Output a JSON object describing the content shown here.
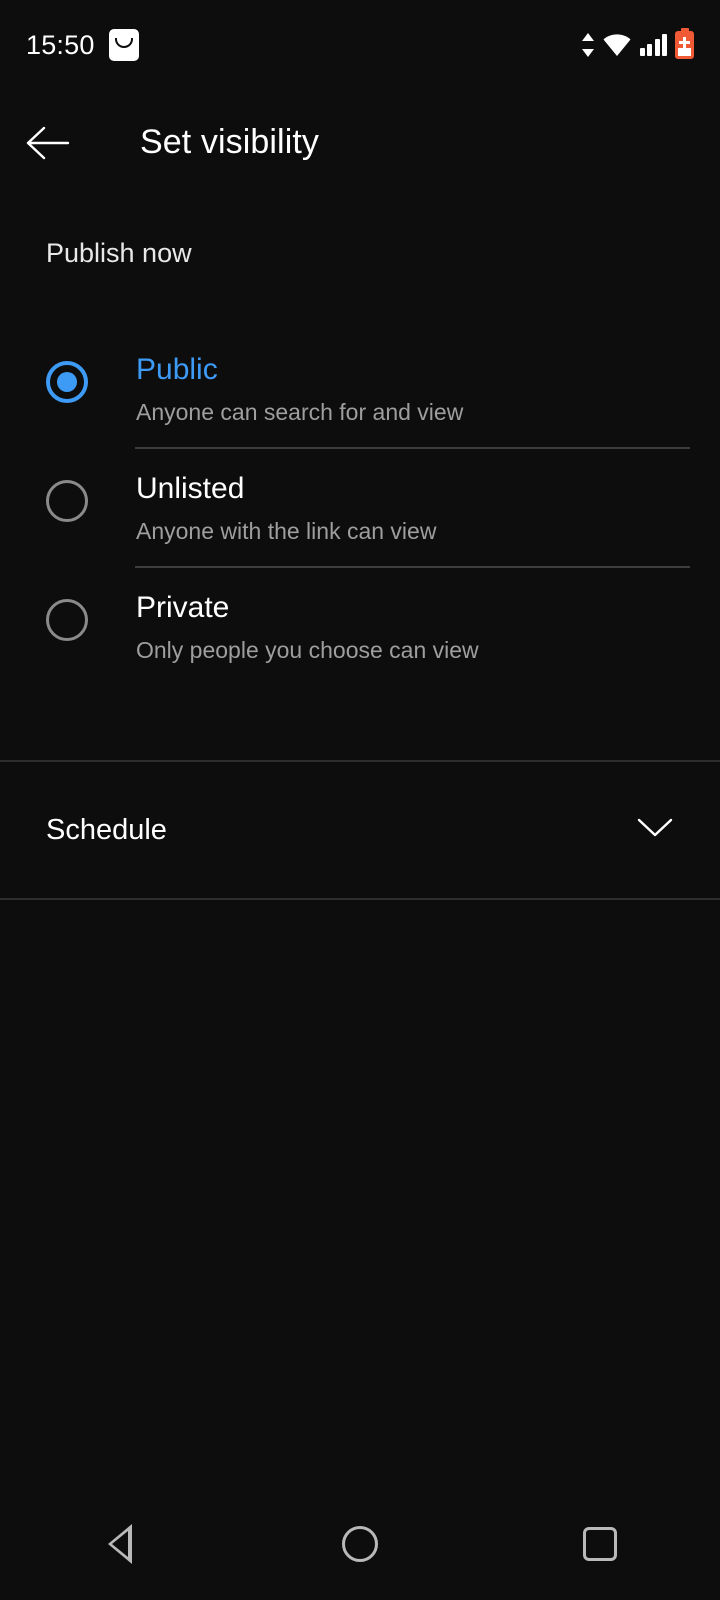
{
  "status_bar": {
    "clock": "15:50",
    "notification_icon": "shopping-bag-icon",
    "icons": [
      "data-transfer-icon",
      "wifi-icon",
      "cellular-signal-icon",
      "battery-charging-icon"
    ],
    "battery_color": "#f05a34"
  },
  "app_bar": {
    "back_icon": "back-arrow-icon",
    "title": "Set visibility"
  },
  "main": {
    "section_header": "Publish now",
    "accent_color": "#3e9bf5",
    "options": [
      {
        "label": "Public",
        "description": "Anyone can search for and view",
        "selected": true
      },
      {
        "label": "Unlisted",
        "description": "Anyone with the link can view",
        "selected": false
      },
      {
        "label": "Private",
        "description": "Only people you choose can view",
        "selected": false
      }
    ],
    "schedule": {
      "label": "Schedule",
      "expand_icon": "chevron-down-icon"
    }
  },
  "nav_bar": {
    "back": "back-triangle-icon",
    "home": "home-circle-icon",
    "recents": "recents-square-icon"
  }
}
